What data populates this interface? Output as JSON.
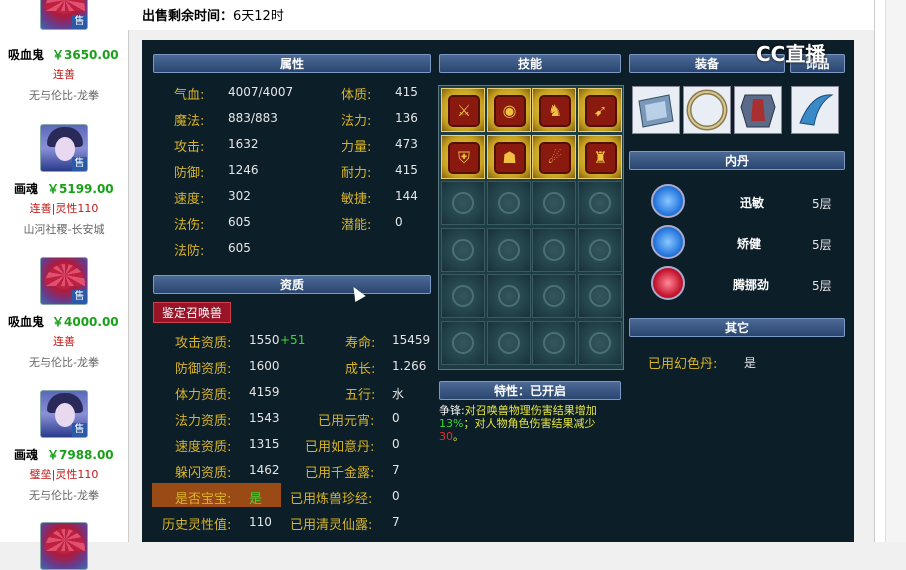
{
  "sidebar": {
    "pets": [
      {
        "name": "",
        "price": "",
        "tag": "",
        "server": "",
        "avatar": "ghost",
        "sell_tag": "售"
      },
      {
        "name": "吸血鬼",
        "price": "￥3650.00",
        "tag": "连善",
        "server": "无与伦比-龙拳",
        "avatar": "ghost",
        "sell_tag": "售"
      },
      {
        "name": "画魂",
        "price": "￥5199.00",
        "tag": "连善|灵性110",
        "server": "山河社稷-长安城",
        "avatar": "soul",
        "sell_tag": "售"
      },
      {
        "name": "吸血鬼",
        "price": "￥4000.00",
        "tag": "连善",
        "server": "无与伦比-龙拳",
        "avatar": "ghost",
        "sell_tag": "售"
      },
      {
        "name": "画魂",
        "price": "￥7988.00",
        "tag": "璧垒|灵性110",
        "server": "无与伦比-龙拳",
        "avatar": "soul",
        "sell_tag": "售"
      }
    ]
  },
  "header": {
    "countdown_label": "出售剩余时间：",
    "countdown_value": "6天12时"
  },
  "watermark": {
    "text": "CC直播"
  },
  "sections": {
    "attributes": "属性",
    "skills": "技能",
    "equipment": "装备",
    "accessory": "饰品",
    "aptitude": "资质",
    "neidan": "内丹",
    "others": "其它",
    "trait": "特性：已开启"
  },
  "attributes": {
    "left": [
      {
        "label": "气血:",
        "value": "4007/4007"
      },
      {
        "label": "魔法:",
        "value": "883/883"
      },
      {
        "label": "攻击:",
        "value": "1632"
      },
      {
        "label": "防御:",
        "value": "1246"
      },
      {
        "label": "速度:",
        "value": "302"
      },
      {
        "label": "法伤:",
        "value": "605"
      },
      {
        "label": "法防:",
        "value": "605"
      }
    ],
    "right": [
      {
        "label": "体质:",
        "value": "415"
      },
      {
        "label": "法力:",
        "value": "136"
      },
      {
        "label": "力量:",
        "value": "473"
      },
      {
        "label": "耐力:",
        "value": "415"
      },
      {
        "label": "敏捷:",
        "value": "144"
      },
      {
        "label": "潜能:",
        "value": "0"
      }
    ]
  },
  "identify_button": "鉴定召唤兽",
  "aptitude": {
    "left": [
      {
        "label": "攻击资质:",
        "value": "1550",
        "bonus": "+51"
      },
      {
        "label": "防御资质:",
        "value": "1600",
        "bonus": ""
      },
      {
        "label": "体力资质:",
        "value": "4159",
        "bonus": ""
      },
      {
        "label": "法力资质:",
        "value": "1543",
        "bonus": ""
      },
      {
        "label": "速度资质:",
        "value": "1315",
        "bonus": ""
      },
      {
        "label": "躲闪资质:",
        "value": "1462",
        "bonus": ""
      },
      {
        "label": "是否宝宝:",
        "value": "是",
        "bonus": ""
      },
      {
        "label": "历史灵性值:",
        "value": "110",
        "bonus": ""
      }
    ],
    "right": [
      {
        "label": "寿命:",
        "value": "15459"
      },
      {
        "label": "成长:",
        "value": "1.266"
      },
      {
        "label": "五行:",
        "value": "水"
      },
      {
        "label": "已用元宵:",
        "value": "0"
      },
      {
        "label": "已用如意丹:",
        "value": "0"
      },
      {
        "label": "已用千金露:",
        "value": "7"
      },
      {
        "label": "已用炼兽珍经:",
        "value": "0"
      },
      {
        "label": "已用清灵仙露:",
        "value": "7"
      }
    ]
  },
  "skills": {
    "active": [
      "sword-icon",
      "eye-icon",
      "figure-icon",
      "bow-icon",
      "shield-icon",
      "owl-icon",
      "beast-icon",
      "mask-icon"
    ],
    "active_glyphs": [
      "⚔",
      "◉",
      "♞",
      "➹",
      "⛨",
      "☗",
      "☄",
      "♜"
    ],
    "empty_count": 16
  },
  "equipment": {
    "items": [
      "bracer-icon",
      "ring-icon",
      "armor-icon"
    ],
    "accessory": "blade-icon"
  },
  "neidan": [
    {
      "name": "迅敏",
      "level": "5层",
      "color": "#2a7ae0"
    },
    {
      "name": "矫健",
      "level": "5层",
      "color": "#2a7ae0"
    },
    {
      "name": "腾挪劲",
      "level": "5层",
      "color": "#c81830"
    }
  ],
  "others": {
    "label": "已用幻色丹:",
    "value": "是"
  },
  "trait": {
    "name": "争锋:",
    "text1": "对召唤兽物理伤害结果增加",
    "pct1": "13%",
    "text2": "；对人物角色伤害结果减少",
    "pct2": "30",
    "end": "。"
  }
}
